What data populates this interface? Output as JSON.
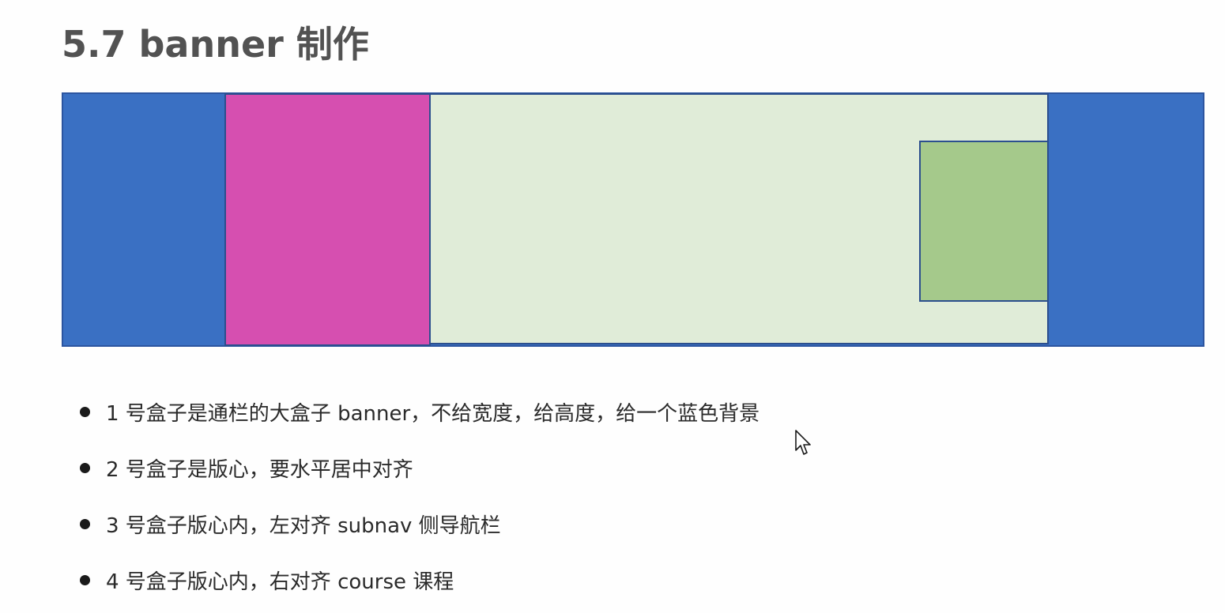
{
  "title": "5.7 banner 制作",
  "colors": {
    "banner": "#3a70c3",
    "subnav": "#d64fb0",
    "container": "#e0ecd8",
    "course": "#a5c98b",
    "border": "#2c4f8e"
  },
  "icons": {
    "bullet": "filled-circle",
    "cursor": "mouse-pointer-arrow"
  },
  "notes": [
    "1 号盒子是通栏的大盒子 banner，不给宽度，给高度，给一个蓝色背景",
    "2 号盒子是版心，要水平居中对齐",
    "3 号盒子版心内，左对齐 subnav 侧导航栏",
    "4 号盒子版心内，右对齐  course 课程"
  ]
}
